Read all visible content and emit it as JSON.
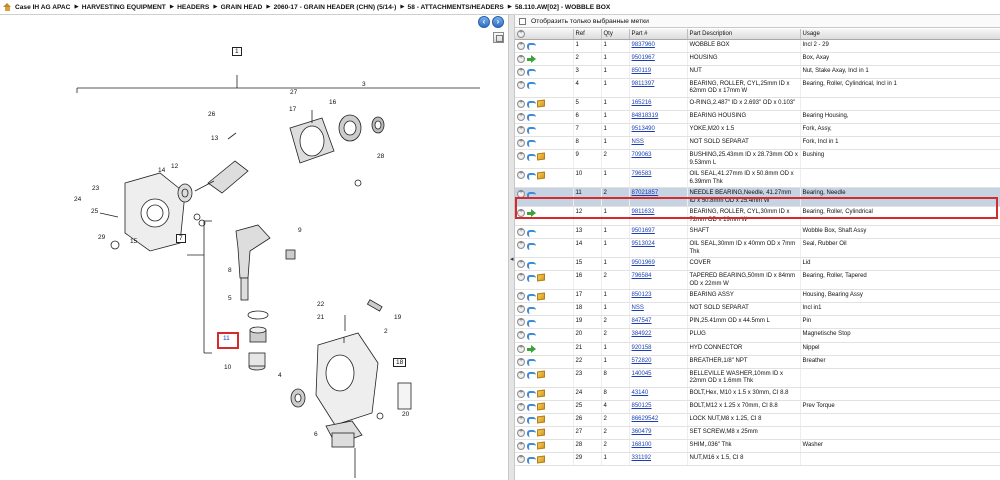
{
  "breadcrumb": [
    "Case IH AG APAC",
    "HARVESTING EQUIPMENT",
    "HEADERS",
    "GRAIN HEAD",
    "2060-17 - GRAIN HEADER (CHN) (5/14-)",
    "58 - ATTACHMENTS/HEADERS",
    "58.110.AW[02] - WOBBLE BOX"
  ],
  "filter_label": "Отобразить только выбранные метки",
  "columns": [
    "Ref",
    "Qty",
    "Part #",
    "Part Description",
    "Usage"
  ],
  "rows": [
    {
      "ref": "1",
      "qty": "1",
      "part": "9837960",
      "desc": "WOBBLE BOX",
      "usage": "Incl 2 - 29",
      "icon": "b"
    },
    {
      "ref": "2",
      "qty": "1",
      "part": "9501967",
      "desc": "HOUSING",
      "usage": "Box, Axay",
      "icon": "g"
    },
    {
      "ref": "3",
      "qty": "1",
      "part": "850119",
      "desc": "NUT",
      "usage": "Nut, Stake Axay, Incl in 1",
      "icon": "b"
    },
    {
      "ref": "4",
      "qty": "1",
      "part": "9811397",
      "desc": "BEARING, ROLLER, CYL,25mm ID x 62mm OD x 17mm W",
      "usage": "Bearing, Roller, Cylindrical, Incl in 1",
      "icon": "b"
    },
    {
      "ref": "5",
      "qty": "1",
      "part": "165216",
      "desc": "O-RING,2.487\" ID x 2.693\" OD x 0.103\"",
      "usage": "",
      "icon": "bc"
    },
    {
      "ref": "6",
      "qty": "1",
      "part": "84818319",
      "desc": "BEARING HOUSING",
      "usage": "Bearing Housing,",
      "icon": "b"
    },
    {
      "ref": "7",
      "qty": "1",
      "part": "9513490",
      "desc": "YOKE,M20 x 1.5",
      "usage": "Fork, Assy,",
      "icon": "b"
    },
    {
      "ref": "8",
      "qty": "1",
      "part": "NSS",
      "desc": "NOT SOLD SEPARAT",
      "usage": "Fork, Incl in 1",
      "icon": "b"
    },
    {
      "ref": "9",
      "qty": "2",
      "part": "709063",
      "desc": "BUSHING,25.43mm ID x 28.73mm OD x 9.53mm L",
      "usage": "Bushing",
      "icon": "bc"
    },
    {
      "ref": "10",
      "qty": "1",
      "part": "796583",
      "desc": "OIL SEAL,41.27mm ID x 50.8mm OD x 6.39mm Thk",
      "usage": "",
      "icon": "bc"
    },
    {
      "ref": "11",
      "qty": "2",
      "part": "87021857",
      "desc": "NEEDLE BEARING,Needle, 41.27mm ID x 50.8mm OD x 25.4mm W",
      "usage": "Bearing, Needle",
      "icon": "b",
      "selected": true
    },
    {
      "ref": "12",
      "qty": "1",
      "part": "9811632",
      "desc": "BEARING, ROLLER, CYL,30mm ID x 72mm OD x 19mm W",
      "usage": "Bearing, Roller, Cylindrical",
      "icon": "g"
    },
    {
      "ref": "13",
      "qty": "1",
      "part": "9501697",
      "desc": "SHAFT",
      "usage": "Wobble Box, Shaft Assy",
      "icon": "b"
    },
    {
      "ref": "14",
      "qty": "1",
      "part": "9513024",
      "desc": "OIL SEAL,30mm ID x 40mm OD x 7mm Thk",
      "usage": "Seal, Rubber Oil",
      "icon": "b"
    },
    {
      "ref": "15",
      "qty": "1",
      "part": "9501969",
      "desc": "COVER",
      "usage": "Lid",
      "icon": "b"
    },
    {
      "ref": "16",
      "qty": "2",
      "part": "796584",
      "desc": "TAPERED BEARING,50mm ID x 84mm OD x 22mm W",
      "usage": "Bearing, Roller, Tapered",
      "icon": "bc"
    },
    {
      "ref": "17",
      "qty": "1",
      "part": "850123",
      "desc": "BEARING ASSY",
      "usage": "Housing, Bearing Assy",
      "icon": "bc"
    },
    {
      "ref": "18",
      "qty": "1",
      "part": "NSS",
      "desc": "NOT SOLD SEPARAT",
      "usage": "Incl in1",
      "icon": "b"
    },
    {
      "ref": "19",
      "qty": "2",
      "part": "847547",
      "desc": "PIN,25.41mm OD x 44.5mm L",
      "usage": "Pin",
      "icon": "b"
    },
    {
      "ref": "20",
      "qty": "2",
      "part": "384922",
      "desc": "PLUG",
      "usage": "Magnetische Stop",
      "icon": "b"
    },
    {
      "ref": "21",
      "qty": "1",
      "part": "920158",
      "desc": "HYD CONNECTOR",
      "usage": "Nippel",
      "icon": "g"
    },
    {
      "ref": "22",
      "qty": "1",
      "part": "572820",
      "desc": "BREATHER,1/8\" NPT",
      "usage": "Breather",
      "icon": "b"
    },
    {
      "ref": "23",
      "qty": "8",
      "part": "140045",
      "desc": "BELLEVILLE WASHER,10mm ID x 22mm OD x 1.6mm Thk",
      "usage": "",
      "icon": "bc"
    },
    {
      "ref": "24",
      "qty": "8",
      "part": "43140",
      "desc": "BOLT,Hex, M10 x 1.5 x 30mm, CI 8.8",
      "usage": "",
      "icon": "bc"
    },
    {
      "ref": "25",
      "qty": "4",
      "part": "850125",
      "desc": "BOLT,M12 x 1.25 x 70mm, CI 8.8",
      "usage": "Prev Torque",
      "icon": "bc"
    },
    {
      "ref": "26",
      "qty": "2",
      "part": "86629542",
      "desc": "LOCK NUT,M8 x 1.25, CI 8",
      "usage": "",
      "icon": "bc"
    },
    {
      "ref": "27",
      "qty": "2",
      "part": "360479",
      "desc": "SET SCREW,M8 x 25mm",
      "usage": "",
      "icon": "bc"
    },
    {
      "ref": "28",
      "qty": "2",
      "part": "168100",
      "desc": "SHIM,.036\" Thk",
      "usage": "Washer",
      "icon": "bc"
    },
    {
      "ref": "29",
      "qty": "1",
      "part": "331192",
      "desc": "NUT,M16 x 1.5, CI 8",
      "usage": "",
      "icon": "bc"
    }
  ],
  "diagram_labels": [
    "1",
    "2",
    "3",
    "4",
    "5",
    "6",
    "7",
    "8",
    "9",
    "10",
    "11",
    "12",
    "13",
    "14",
    "15",
    "16",
    "17",
    "18",
    "19",
    "20",
    "21",
    "22",
    "23",
    "24",
    "25",
    "26",
    "27",
    "28",
    "29"
  ]
}
